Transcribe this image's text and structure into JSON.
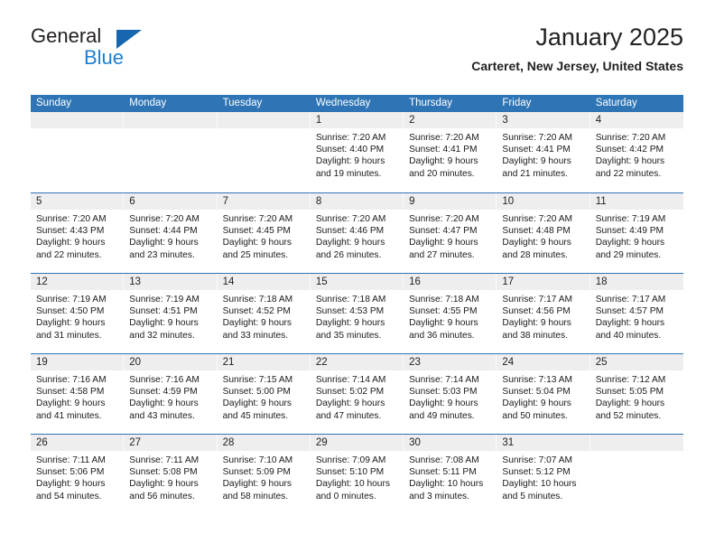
{
  "brand": {
    "word1": "General",
    "word2": "Blue",
    "mark": "triangle-logo"
  },
  "header": {
    "title": "January 2025",
    "location": "Carteret, New Jersey, United States"
  },
  "colors": {
    "header_blue": "#2f75b5",
    "day_head_grey": "#eeeeee",
    "brand_blue": "#1f7fd1",
    "logo_blue": "#1667ae"
  },
  "weekdays": [
    "Sunday",
    "Monday",
    "Tuesday",
    "Wednesday",
    "Thursday",
    "Friday",
    "Saturday"
  ],
  "weeks": [
    [
      {
        "day": "",
        "empty": true,
        "sunrise": "",
        "sunset": "",
        "daylight1": "",
        "daylight2": ""
      },
      {
        "day": "",
        "empty": true,
        "sunrise": "",
        "sunset": "",
        "daylight1": "",
        "daylight2": ""
      },
      {
        "day": "",
        "empty": true,
        "sunrise": "",
        "sunset": "",
        "daylight1": "",
        "daylight2": ""
      },
      {
        "day": "1",
        "sunrise": "Sunrise: 7:20 AM",
        "sunset": "Sunset: 4:40 PM",
        "daylight1": "Daylight: 9 hours",
        "daylight2": "and 19 minutes."
      },
      {
        "day": "2",
        "sunrise": "Sunrise: 7:20 AM",
        "sunset": "Sunset: 4:41 PM",
        "daylight1": "Daylight: 9 hours",
        "daylight2": "and 20 minutes."
      },
      {
        "day": "3",
        "sunrise": "Sunrise: 7:20 AM",
        "sunset": "Sunset: 4:41 PM",
        "daylight1": "Daylight: 9 hours",
        "daylight2": "and 21 minutes."
      },
      {
        "day": "4",
        "sunrise": "Sunrise: 7:20 AM",
        "sunset": "Sunset: 4:42 PM",
        "daylight1": "Daylight: 9 hours",
        "daylight2": "and 22 minutes."
      }
    ],
    [
      {
        "day": "5",
        "sunrise": "Sunrise: 7:20 AM",
        "sunset": "Sunset: 4:43 PM",
        "daylight1": "Daylight: 9 hours",
        "daylight2": "and 22 minutes."
      },
      {
        "day": "6",
        "sunrise": "Sunrise: 7:20 AM",
        "sunset": "Sunset: 4:44 PM",
        "daylight1": "Daylight: 9 hours",
        "daylight2": "and 23 minutes."
      },
      {
        "day": "7",
        "sunrise": "Sunrise: 7:20 AM",
        "sunset": "Sunset: 4:45 PM",
        "daylight1": "Daylight: 9 hours",
        "daylight2": "and 25 minutes."
      },
      {
        "day": "8",
        "sunrise": "Sunrise: 7:20 AM",
        "sunset": "Sunset: 4:46 PM",
        "daylight1": "Daylight: 9 hours",
        "daylight2": "and 26 minutes."
      },
      {
        "day": "9",
        "sunrise": "Sunrise: 7:20 AM",
        "sunset": "Sunset: 4:47 PM",
        "daylight1": "Daylight: 9 hours",
        "daylight2": "and 27 minutes."
      },
      {
        "day": "10",
        "sunrise": "Sunrise: 7:20 AM",
        "sunset": "Sunset: 4:48 PM",
        "daylight1": "Daylight: 9 hours",
        "daylight2": "and 28 minutes."
      },
      {
        "day": "11",
        "sunrise": "Sunrise: 7:19 AM",
        "sunset": "Sunset: 4:49 PM",
        "daylight1": "Daylight: 9 hours",
        "daylight2": "and 29 minutes."
      }
    ],
    [
      {
        "day": "12",
        "sunrise": "Sunrise: 7:19 AM",
        "sunset": "Sunset: 4:50 PM",
        "daylight1": "Daylight: 9 hours",
        "daylight2": "and 31 minutes."
      },
      {
        "day": "13",
        "sunrise": "Sunrise: 7:19 AM",
        "sunset": "Sunset: 4:51 PM",
        "daylight1": "Daylight: 9 hours",
        "daylight2": "and 32 minutes."
      },
      {
        "day": "14",
        "sunrise": "Sunrise: 7:18 AM",
        "sunset": "Sunset: 4:52 PM",
        "daylight1": "Daylight: 9 hours",
        "daylight2": "and 33 minutes."
      },
      {
        "day": "15",
        "sunrise": "Sunrise: 7:18 AM",
        "sunset": "Sunset: 4:53 PM",
        "daylight1": "Daylight: 9 hours",
        "daylight2": "and 35 minutes."
      },
      {
        "day": "16",
        "sunrise": "Sunrise: 7:18 AM",
        "sunset": "Sunset: 4:55 PM",
        "daylight1": "Daylight: 9 hours",
        "daylight2": "and 36 minutes."
      },
      {
        "day": "17",
        "sunrise": "Sunrise: 7:17 AM",
        "sunset": "Sunset: 4:56 PM",
        "daylight1": "Daylight: 9 hours",
        "daylight2": "and 38 minutes."
      },
      {
        "day": "18",
        "sunrise": "Sunrise: 7:17 AM",
        "sunset": "Sunset: 4:57 PM",
        "daylight1": "Daylight: 9 hours",
        "daylight2": "and 40 minutes."
      }
    ],
    [
      {
        "day": "19",
        "sunrise": "Sunrise: 7:16 AM",
        "sunset": "Sunset: 4:58 PM",
        "daylight1": "Daylight: 9 hours",
        "daylight2": "and 41 minutes."
      },
      {
        "day": "20",
        "sunrise": "Sunrise: 7:16 AM",
        "sunset": "Sunset: 4:59 PM",
        "daylight1": "Daylight: 9 hours",
        "daylight2": "and 43 minutes."
      },
      {
        "day": "21",
        "sunrise": "Sunrise: 7:15 AM",
        "sunset": "Sunset: 5:00 PM",
        "daylight1": "Daylight: 9 hours",
        "daylight2": "and 45 minutes."
      },
      {
        "day": "22",
        "sunrise": "Sunrise: 7:14 AM",
        "sunset": "Sunset: 5:02 PM",
        "daylight1": "Daylight: 9 hours",
        "daylight2": "and 47 minutes."
      },
      {
        "day": "23",
        "sunrise": "Sunrise: 7:14 AM",
        "sunset": "Sunset: 5:03 PM",
        "daylight1": "Daylight: 9 hours",
        "daylight2": "and 49 minutes."
      },
      {
        "day": "24",
        "sunrise": "Sunrise: 7:13 AM",
        "sunset": "Sunset: 5:04 PM",
        "daylight1": "Daylight: 9 hours",
        "daylight2": "and 50 minutes."
      },
      {
        "day": "25",
        "sunrise": "Sunrise: 7:12 AM",
        "sunset": "Sunset: 5:05 PM",
        "daylight1": "Daylight: 9 hours",
        "daylight2": "and 52 minutes."
      }
    ],
    [
      {
        "day": "26",
        "sunrise": "Sunrise: 7:11 AM",
        "sunset": "Sunset: 5:06 PM",
        "daylight1": "Daylight: 9 hours",
        "daylight2": "and 54 minutes."
      },
      {
        "day": "27",
        "sunrise": "Sunrise: 7:11 AM",
        "sunset": "Sunset: 5:08 PM",
        "daylight1": "Daylight: 9 hours",
        "daylight2": "and 56 minutes."
      },
      {
        "day": "28",
        "sunrise": "Sunrise: 7:10 AM",
        "sunset": "Sunset: 5:09 PM",
        "daylight1": "Daylight: 9 hours",
        "daylight2": "and 58 minutes."
      },
      {
        "day": "29",
        "sunrise": "Sunrise: 7:09 AM",
        "sunset": "Sunset: 5:10 PM",
        "daylight1": "Daylight: 10 hours",
        "daylight2": "and 0 minutes."
      },
      {
        "day": "30",
        "sunrise": "Sunrise: 7:08 AM",
        "sunset": "Sunset: 5:11 PM",
        "daylight1": "Daylight: 10 hours",
        "daylight2": "and 3 minutes."
      },
      {
        "day": "31",
        "sunrise": "Sunrise: 7:07 AM",
        "sunset": "Sunset: 5:12 PM",
        "daylight1": "Daylight: 10 hours",
        "daylight2": "and 5 minutes."
      },
      {
        "day": "",
        "empty": true,
        "sunrise": "",
        "sunset": "",
        "daylight1": "",
        "daylight2": ""
      }
    ]
  ]
}
